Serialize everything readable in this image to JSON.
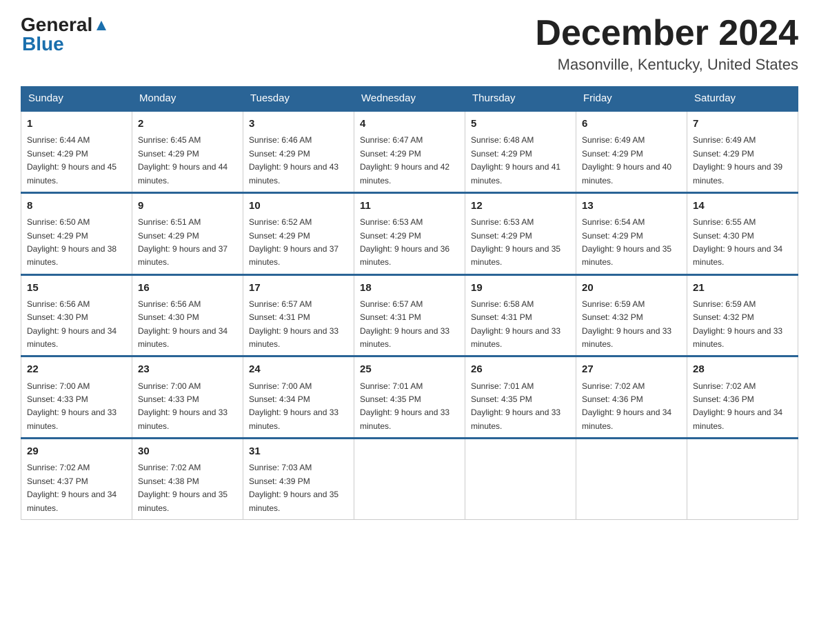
{
  "header": {
    "logo_general": "General",
    "logo_blue": "Blue",
    "month_title": "December 2024",
    "location": "Masonville, Kentucky, United States"
  },
  "days_of_week": [
    "Sunday",
    "Monday",
    "Tuesday",
    "Wednesday",
    "Thursday",
    "Friday",
    "Saturday"
  ],
  "weeks": [
    [
      {
        "num": "1",
        "sunrise": "6:44 AM",
        "sunset": "4:29 PM",
        "daylight": "9 hours and 45 minutes."
      },
      {
        "num": "2",
        "sunrise": "6:45 AM",
        "sunset": "4:29 PM",
        "daylight": "9 hours and 44 minutes."
      },
      {
        "num": "3",
        "sunrise": "6:46 AM",
        "sunset": "4:29 PM",
        "daylight": "9 hours and 43 minutes."
      },
      {
        "num": "4",
        "sunrise": "6:47 AM",
        "sunset": "4:29 PM",
        "daylight": "9 hours and 42 minutes."
      },
      {
        "num": "5",
        "sunrise": "6:48 AM",
        "sunset": "4:29 PM",
        "daylight": "9 hours and 41 minutes."
      },
      {
        "num": "6",
        "sunrise": "6:49 AM",
        "sunset": "4:29 PM",
        "daylight": "9 hours and 40 minutes."
      },
      {
        "num": "7",
        "sunrise": "6:49 AM",
        "sunset": "4:29 PM",
        "daylight": "9 hours and 39 minutes."
      }
    ],
    [
      {
        "num": "8",
        "sunrise": "6:50 AM",
        "sunset": "4:29 PM",
        "daylight": "9 hours and 38 minutes."
      },
      {
        "num": "9",
        "sunrise": "6:51 AM",
        "sunset": "4:29 PM",
        "daylight": "9 hours and 37 minutes."
      },
      {
        "num": "10",
        "sunrise": "6:52 AM",
        "sunset": "4:29 PM",
        "daylight": "9 hours and 37 minutes."
      },
      {
        "num": "11",
        "sunrise": "6:53 AM",
        "sunset": "4:29 PM",
        "daylight": "9 hours and 36 minutes."
      },
      {
        "num": "12",
        "sunrise": "6:53 AM",
        "sunset": "4:29 PM",
        "daylight": "9 hours and 35 minutes."
      },
      {
        "num": "13",
        "sunrise": "6:54 AM",
        "sunset": "4:29 PM",
        "daylight": "9 hours and 35 minutes."
      },
      {
        "num": "14",
        "sunrise": "6:55 AM",
        "sunset": "4:30 PM",
        "daylight": "9 hours and 34 minutes."
      }
    ],
    [
      {
        "num": "15",
        "sunrise": "6:56 AM",
        "sunset": "4:30 PM",
        "daylight": "9 hours and 34 minutes."
      },
      {
        "num": "16",
        "sunrise": "6:56 AM",
        "sunset": "4:30 PM",
        "daylight": "9 hours and 34 minutes."
      },
      {
        "num": "17",
        "sunrise": "6:57 AM",
        "sunset": "4:31 PM",
        "daylight": "9 hours and 33 minutes."
      },
      {
        "num": "18",
        "sunrise": "6:57 AM",
        "sunset": "4:31 PM",
        "daylight": "9 hours and 33 minutes."
      },
      {
        "num": "19",
        "sunrise": "6:58 AM",
        "sunset": "4:31 PM",
        "daylight": "9 hours and 33 minutes."
      },
      {
        "num": "20",
        "sunrise": "6:59 AM",
        "sunset": "4:32 PM",
        "daylight": "9 hours and 33 minutes."
      },
      {
        "num": "21",
        "sunrise": "6:59 AM",
        "sunset": "4:32 PM",
        "daylight": "9 hours and 33 minutes."
      }
    ],
    [
      {
        "num": "22",
        "sunrise": "7:00 AM",
        "sunset": "4:33 PM",
        "daylight": "9 hours and 33 minutes."
      },
      {
        "num": "23",
        "sunrise": "7:00 AM",
        "sunset": "4:33 PM",
        "daylight": "9 hours and 33 minutes."
      },
      {
        "num": "24",
        "sunrise": "7:00 AM",
        "sunset": "4:34 PM",
        "daylight": "9 hours and 33 minutes."
      },
      {
        "num": "25",
        "sunrise": "7:01 AM",
        "sunset": "4:35 PM",
        "daylight": "9 hours and 33 minutes."
      },
      {
        "num": "26",
        "sunrise": "7:01 AM",
        "sunset": "4:35 PM",
        "daylight": "9 hours and 33 minutes."
      },
      {
        "num": "27",
        "sunrise": "7:02 AM",
        "sunset": "4:36 PM",
        "daylight": "9 hours and 34 minutes."
      },
      {
        "num": "28",
        "sunrise": "7:02 AM",
        "sunset": "4:36 PM",
        "daylight": "9 hours and 34 minutes."
      }
    ],
    [
      {
        "num": "29",
        "sunrise": "7:02 AM",
        "sunset": "4:37 PM",
        "daylight": "9 hours and 34 minutes."
      },
      {
        "num": "30",
        "sunrise": "7:02 AM",
        "sunset": "4:38 PM",
        "daylight": "9 hours and 35 minutes."
      },
      {
        "num": "31",
        "sunrise": "7:03 AM",
        "sunset": "4:39 PM",
        "daylight": "9 hours and 35 minutes."
      },
      null,
      null,
      null,
      null
    ]
  ]
}
